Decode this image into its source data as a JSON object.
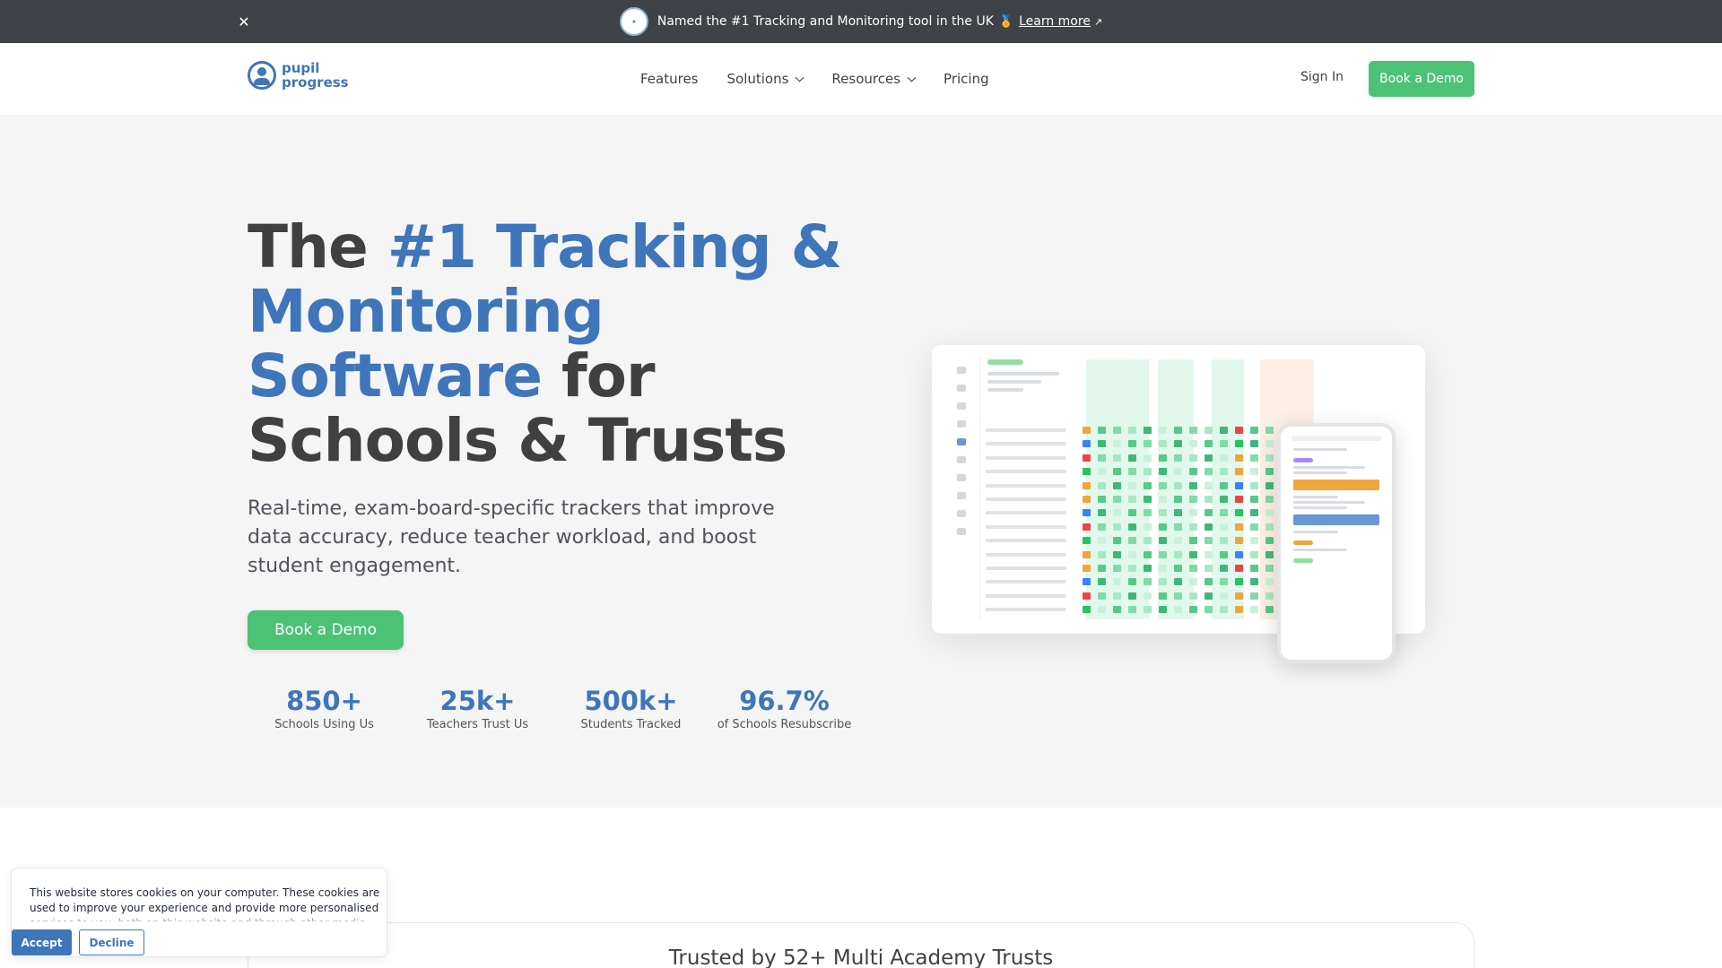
{
  "announcement": {
    "text": "Named the #1 Tracking and Monitoring tool in the UK",
    "link": "Learn more",
    "close_icon": "close-icon",
    "medal_icon": "medal-icon",
    "external_icon": "external-link-icon"
  },
  "header": {
    "logo_line1": "pupil",
    "logo_line2": "progress",
    "nav": {
      "features": "Features",
      "solutions": "Solutions",
      "resources": "Resources",
      "pricing": "Pricing"
    },
    "sign_in": "Sign In",
    "demo": "Book a Demo"
  },
  "hero": {
    "headline": {
      "the": "The ",
      "blue": "#1 Tracking & Monitoring Software",
      "rest": " for Schools & Trusts"
    },
    "subline": "Real-time, exam-board-specific trackers that improve data accuracy, reduce teacher workload, and boost student engagement.",
    "demo": "Book a Demo",
    "stats": [
      {
        "value": "850+",
        "label": "Schools Using Us"
      },
      {
        "value": "25k+",
        "label": "Teachers Trust Us"
      },
      {
        "value": "500k+",
        "label": "Students Tracked"
      },
      {
        "value": "96.7%",
        "label": "of Schools Resubscribe"
      }
    ]
  },
  "trusted": {
    "title": "Trusted by 52+ Multi Academy Trusts"
  },
  "cookie": {
    "text": "This website stores cookies on your computer. These cookies are used to improve your experience and provide more personalised services to you, both on this website and through other media.",
    "accept": "Accept",
    "decline": "Decline"
  },
  "colors": {
    "brand_blue": "#3f75ba",
    "cta_green": "#4cc277",
    "announce_bg": "#3f4246",
    "hero_bg": "#f5f5f6"
  }
}
